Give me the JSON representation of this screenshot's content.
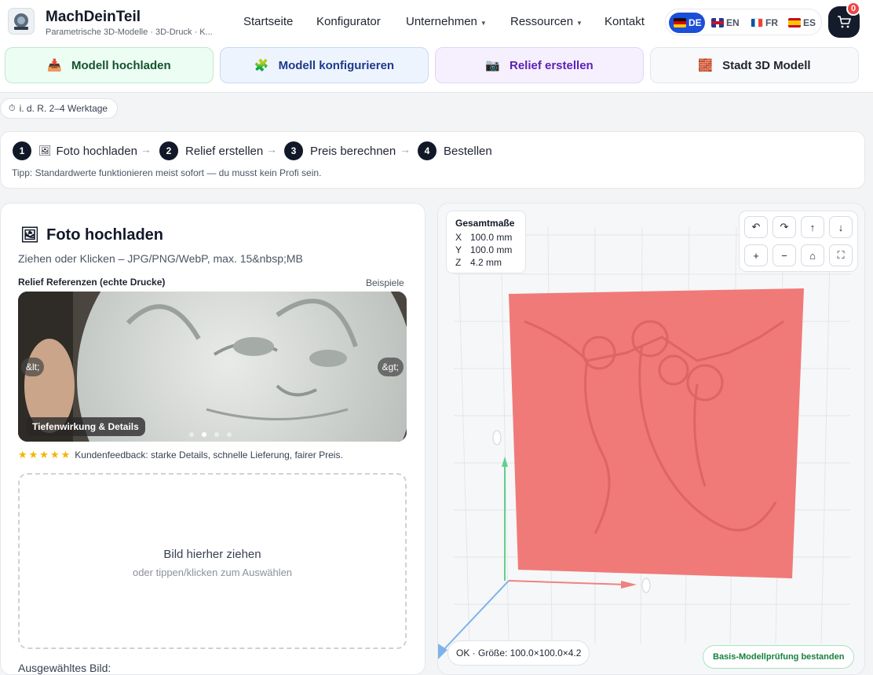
{
  "header": {
    "brand_title": "MachDeinTeil",
    "brand_subtitle": "Parametrische 3D-Modelle · 3D-Druck · K...",
    "nav": [
      {
        "label": "Startseite"
      },
      {
        "label": "Konfigurator"
      },
      {
        "label": "Unternehmen"
      },
      {
        "label": "Ressourcen"
      },
      {
        "label": "Kontakt"
      }
    ],
    "languages": [
      {
        "code": "DE",
        "flag": "de-flag-icon",
        "active": true
      },
      {
        "code": "EN",
        "flag": "gb-flag-icon"
      },
      {
        "code": "FR",
        "flag": "fr-flag-icon"
      },
      {
        "code": "ES",
        "flag": "es-flag-icon"
      }
    ],
    "cart_count": "0"
  },
  "actions": [
    {
      "label": "Modell hochladen",
      "icon": "upload-box-icon"
    },
    {
      "label": "Modell konfigurieren",
      "icon": "puzzle-icon"
    },
    {
      "label": "Relief erstellen",
      "icon": "camera-icon"
    },
    {
      "label": "Stadt 3D Modell",
      "icon": "bricks-icon"
    }
  ],
  "eta": "i. d. R. 2–4 Werktage",
  "steps": [
    {
      "num": "1",
      "label": "Foto hochladen",
      "icon": "picture-icon"
    },
    {
      "num": "2",
      "label": "Relief erstellen"
    },
    {
      "num": "3",
      "label": "Preis berechnen"
    },
    {
      "num": "4",
      "label": "Bestellen"
    }
  ],
  "tip": "Tipp: Standardwerte funktionieren meist sofort — du musst kein Profi sein.",
  "upload": {
    "title": "Foto hochladen",
    "subtitle": "Ziehen oder Klicken – JPG/PNG/WebP, max. 15&nbsp;MB",
    "references_label": "Relief Referenzen (echte Drucke)",
    "examples_link": "Beispiele",
    "carousel": {
      "prev": "&lt;",
      "next": "&gt;",
      "caption": "Tiefenwirkung & Details",
      "slide_count": 4,
      "active_slide": 2
    },
    "rating_stars": 5,
    "feedback": "Kundenfeedback: starke Details, schnelle Lieferung, fairer Preis.",
    "dropzone_title": "Bild hierher ziehen",
    "dropzone_sub": "oder tippen/klicken zum Auswählen",
    "selected_label": "Ausgewähltes Bild:"
  },
  "viewer": {
    "dims_title": "Gesamtmaße",
    "dims": [
      {
        "axis": "X",
        "value": "100.0 mm"
      },
      {
        "axis": "Y",
        "value": "100.0 mm"
      },
      {
        "axis": "Z",
        "value": "4.2 mm"
      }
    ],
    "controls": [
      {
        "glyph": "↶",
        "name": "rotate-left-button"
      },
      {
        "glyph": "↷",
        "name": "rotate-right-button"
      },
      {
        "glyph": "↑",
        "name": "tilt-up-button"
      },
      {
        "glyph": "↓",
        "name": "tilt-down-button"
      },
      {
        "glyph": "+",
        "name": "zoom-in-button"
      },
      {
        "glyph": "−",
        "name": "zoom-out-button"
      },
      {
        "glyph": "⌂",
        "name": "reset-view-button"
      },
      {
        "glyph": "⛶",
        "name": "fullscreen-button"
      }
    ],
    "status": "OK · Größe: 100.0×100.0×4.2",
    "check": "Basis-Modellprüfung bestanden",
    "model_color": "#f07a78"
  }
}
